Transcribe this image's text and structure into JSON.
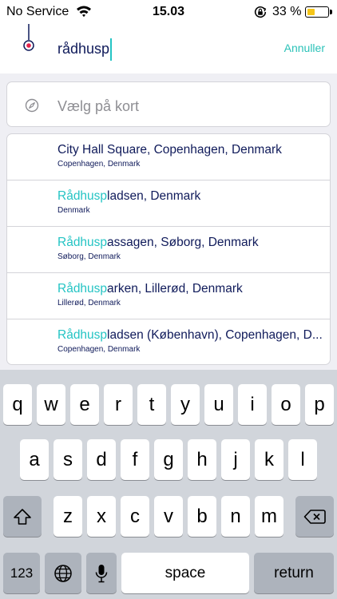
{
  "status_bar": {
    "carrier": "No Service",
    "time": "15.03",
    "battery_percent": "33 %",
    "battery_level": 0.33
  },
  "search": {
    "value": "rådhusp",
    "cancel_label": "Annuller"
  },
  "map_pick": {
    "label": "Vælg på kort"
  },
  "results": [
    {
      "title_highlight": "",
      "title_rest": "City Hall Square, Copenhagen, Denmark",
      "subtitle": "Copenhagen, Denmark"
    },
    {
      "title_highlight": "Rådhusp",
      "title_rest": "ladsen, Denmark",
      "subtitle": "Denmark"
    },
    {
      "title_highlight": "Rådhusp",
      "title_rest": "assagen, Søborg, Denmark",
      "subtitle": "Søborg, Denmark"
    },
    {
      "title_highlight": "Rådhusp",
      "title_rest": "arken, Lillerød, Denmark",
      "subtitle": "Lillerød, Denmark"
    },
    {
      "title_highlight": "Rådhusp",
      "title_rest": "ladsen (København), Copenhagen, D...",
      "subtitle": "Copenhagen, Denmark"
    }
  ],
  "keyboard": {
    "row1": [
      "q",
      "w",
      "e",
      "r",
      "t",
      "y",
      "u",
      "i",
      "o",
      "p"
    ],
    "row2": [
      "a",
      "s",
      "d",
      "f",
      "g",
      "h",
      "j",
      "k",
      "l"
    ],
    "row3": [
      "z",
      "x",
      "c",
      "v",
      "b",
      "n",
      "m"
    ],
    "numbers_label": "123",
    "space_label": "space",
    "return_label": "return"
  },
  "colors": {
    "accent": "#24c4c4",
    "text_primary": "#0f1a5a",
    "marker_red": "#e5214b"
  }
}
